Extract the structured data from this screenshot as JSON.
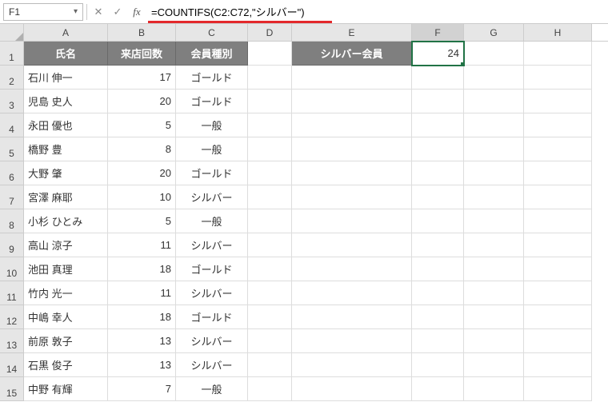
{
  "nameBox": "F1",
  "formula": "=COUNTIFS(C2:C72,\"シルバー\")",
  "colLabels": [
    "A",
    "B",
    "C",
    "D",
    "E",
    "F",
    "G",
    "H"
  ],
  "headers": {
    "a": "氏名",
    "b": "来店回数",
    "c": "会員種別",
    "e": "シルバー会員"
  },
  "f1": "24",
  "rows": [
    {
      "n": "2",
      "a": "石川 伸一",
      "b": "17",
      "c": "ゴールド"
    },
    {
      "n": "3",
      "a": "児島 史人",
      "b": "20",
      "c": "ゴールド"
    },
    {
      "n": "4",
      "a": "永田 優也",
      "b": "5",
      "c": "一般"
    },
    {
      "n": "5",
      "a": "橋野 豊",
      "b": "8",
      "c": "一般"
    },
    {
      "n": "6",
      "a": "大野 肇",
      "b": "20",
      "c": "ゴールド"
    },
    {
      "n": "7",
      "a": "宮澤 麻耶",
      "b": "10",
      "c": "シルバー"
    },
    {
      "n": "8",
      "a": "小杉 ひとみ",
      "b": "5",
      "c": "一般"
    },
    {
      "n": "9",
      "a": "高山 涼子",
      "b": "11",
      "c": "シルバー"
    },
    {
      "n": "10",
      "a": "池田 真理",
      "b": "18",
      "c": "ゴールド"
    },
    {
      "n": "11",
      "a": "竹内 光一",
      "b": "11",
      "c": "シルバー"
    },
    {
      "n": "12",
      "a": "中嶋 幸人",
      "b": "18",
      "c": "ゴールド"
    },
    {
      "n": "13",
      "a": "前原 敦子",
      "b": "13",
      "c": "シルバー"
    },
    {
      "n": "14",
      "a": "石黒 俊子",
      "b": "13",
      "c": "シルバー"
    },
    {
      "n": "15",
      "a": "中野 有輝",
      "b": "7",
      "c": "一般"
    }
  ]
}
